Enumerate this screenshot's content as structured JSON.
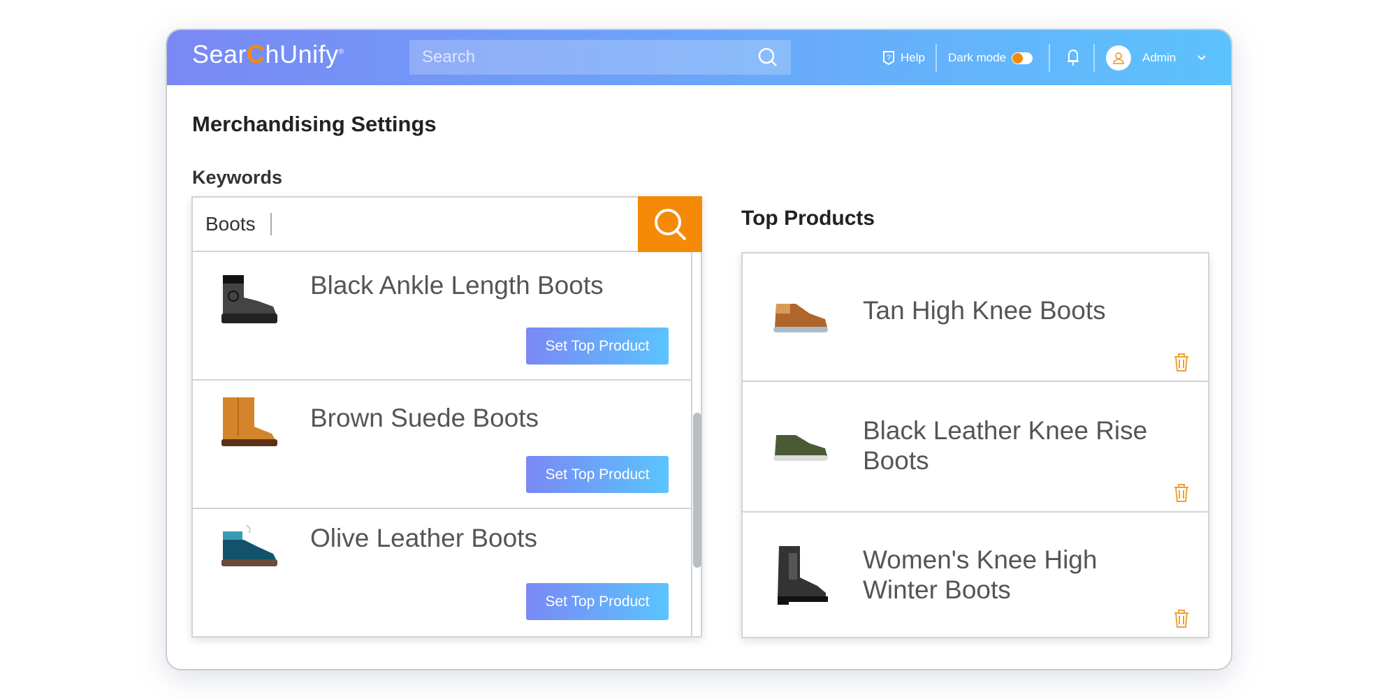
{
  "header": {
    "logo": {
      "pre": "Sear",
      "c": "C",
      "post": "hUnify",
      "reg": "®"
    },
    "search_placeholder": "Search",
    "help": "Help",
    "dark_mode": "Dark mode",
    "dark_mode_on": true,
    "user": "Admin"
  },
  "page": {
    "title": "Merchandising Settings",
    "keywords_label": "Keywords",
    "keyword_value": "Boots",
    "top_products_label": "Top Products"
  },
  "results": [
    {
      "name": "Black Ankle Length Boots",
      "button": "Set Top Product",
      "image": "black-ankle-boot"
    },
    {
      "name": "Brown Suede Boots",
      "button": "Set Top Product",
      "image": "brown-suede-boot"
    },
    {
      "name": "Olive Leather Boots",
      "button": "Set Top Product",
      "image": "teal-hiking-boot"
    }
  ],
  "top_products": [
    {
      "name": "Tan High Knee Boots",
      "image": "tan-sneaker"
    },
    {
      "name": "Black Leather Knee Rise Boots",
      "image": "olive-sneaker"
    },
    {
      "name": "Women's Knee High Winter Boots",
      "image": "black-chelsea-boot"
    }
  ],
  "colors": {
    "accent": "#f58a07",
    "header_start": "#7a88f5",
    "header_end": "#5cc2fd",
    "trash": "#f0a030"
  }
}
